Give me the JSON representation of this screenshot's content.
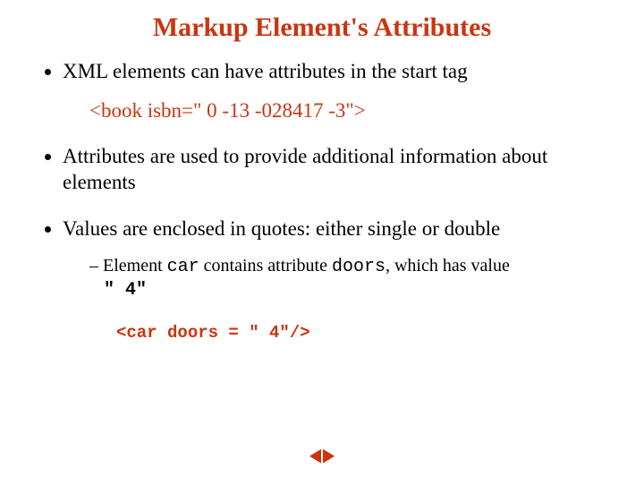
{
  "title": "Markup Element's Attributes",
  "bullets": {
    "b1": "XML elements can have attributes in the start tag",
    "code1": "<book isbn=\" 0 -13 -028417 -3\">",
    "b2": "Attributes are used to provide additional information about elements",
    "b3": "Values are enclosed in quotes: either single or double",
    "sub1_a": "Element ",
    "sub1_car": "car",
    "sub1_b": " contains attribute ",
    "sub1_doors": "doors",
    "sub1_c": ", which has value ",
    "sub1_val": "\" 4\"",
    "code2": "<car doors = \" 4\"/>"
  },
  "nav": {
    "prev": "previous",
    "next": "next"
  }
}
